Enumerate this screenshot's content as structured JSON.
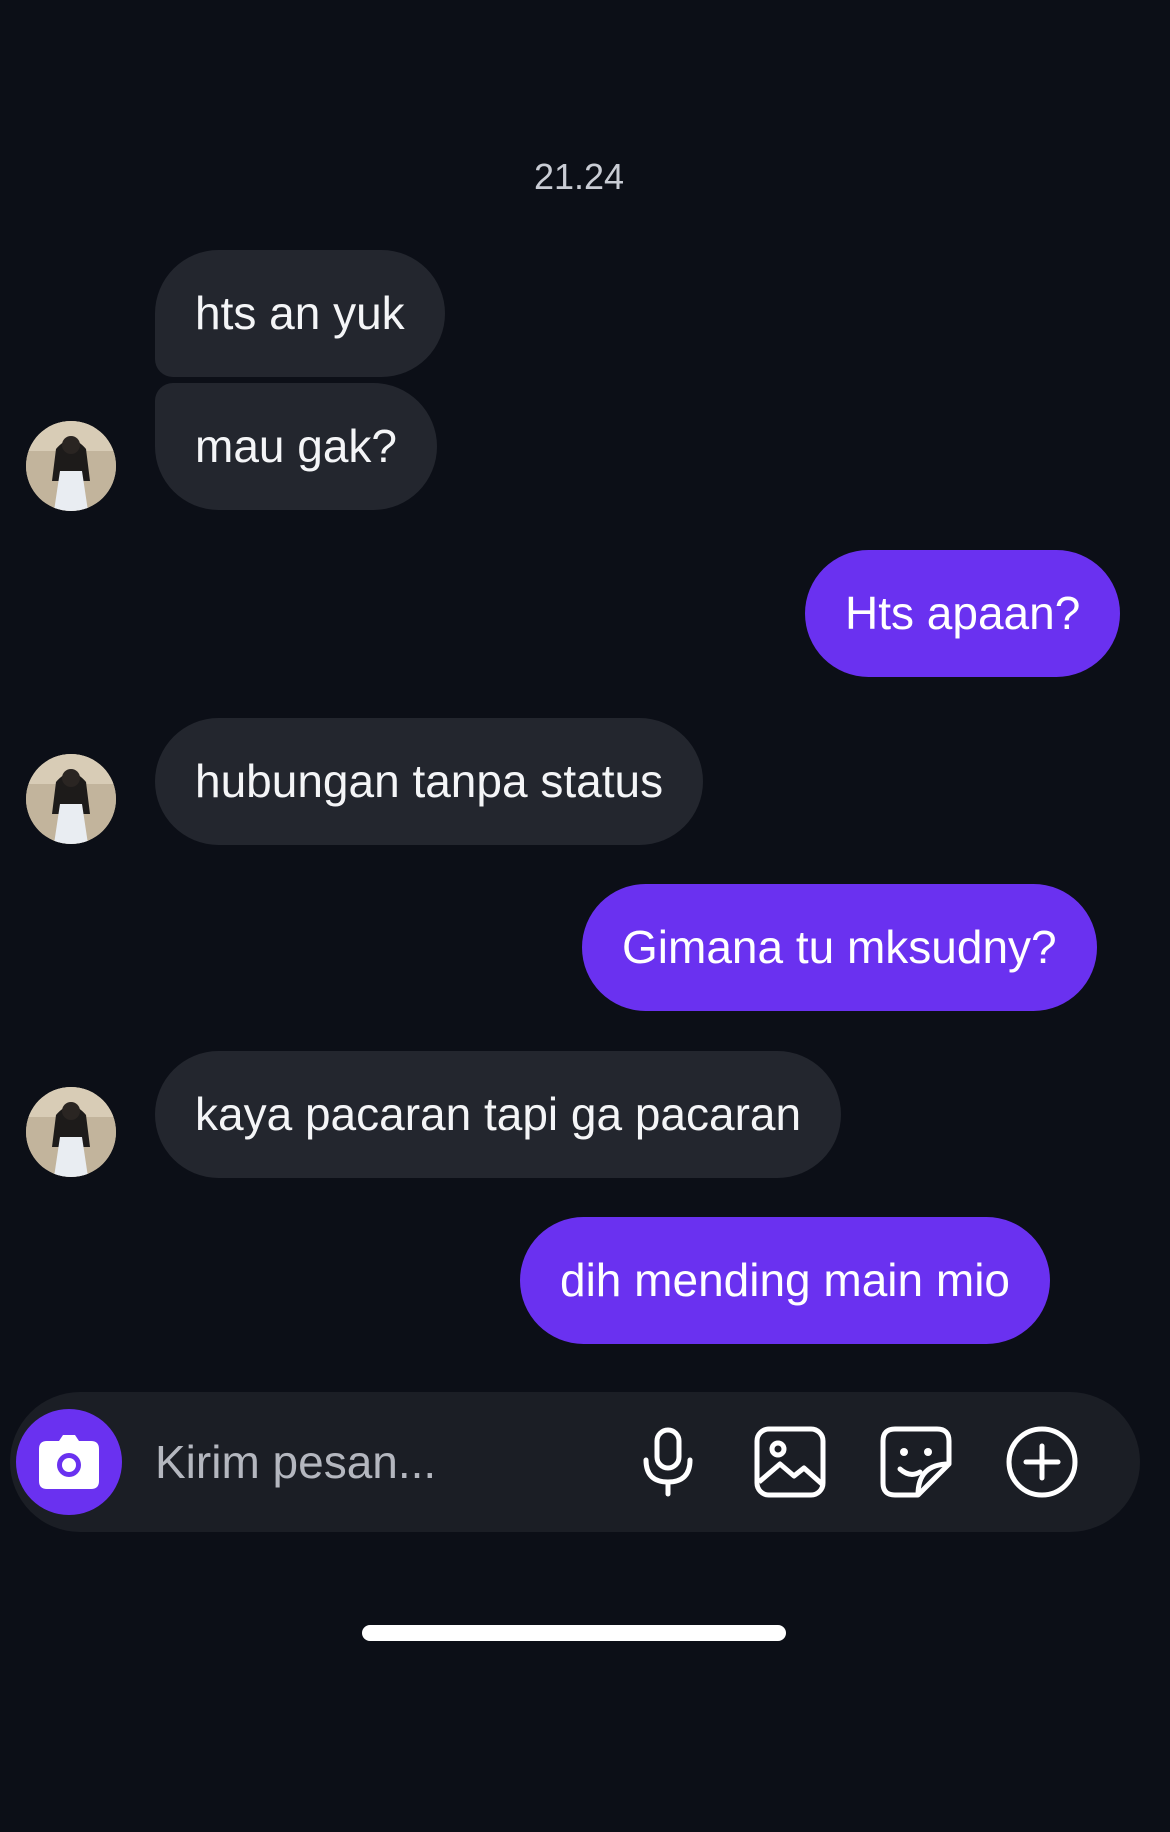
{
  "chat": {
    "timestamp": "21.24",
    "messages": [
      {
        "sender": "them",
        "text": "hts an yuk"
      },
      {
        "sender": "them",
        "text": "mau gak?"
      },
      {
        "sender": "me",
        "text": "Hts apaan?"
      },
      {
        "sender": "them",
        "text": "hubungan tanpa status"
      },
      {
        "sender": "me",
        "text": "Gimana tu mksudny?"
      },
      {
        "sender": "them",
        "text": "kaya pacaran tapi ga pacaran"
      },
      {
        "sender": "me",
        "text": "dih mending main mio"
      }
    ]
  },
  "composer": {
    "placeholder": "Kirim pesan...",
    "icons": {
      "camera": "camera-icon",
      "microphone": "microphone-icon",
      "gallery": "image-icon",
      "sticker": "sticker-icon",
      "more": "plus-circle-icon"
    }
  },
  "colors": {
    "background": "#0c0f17",
    "incoming_bubble": "#23262e",
    "outgoing_bubble": "#6a31f0",
    "accent": "#6a31f0"
  }
}
